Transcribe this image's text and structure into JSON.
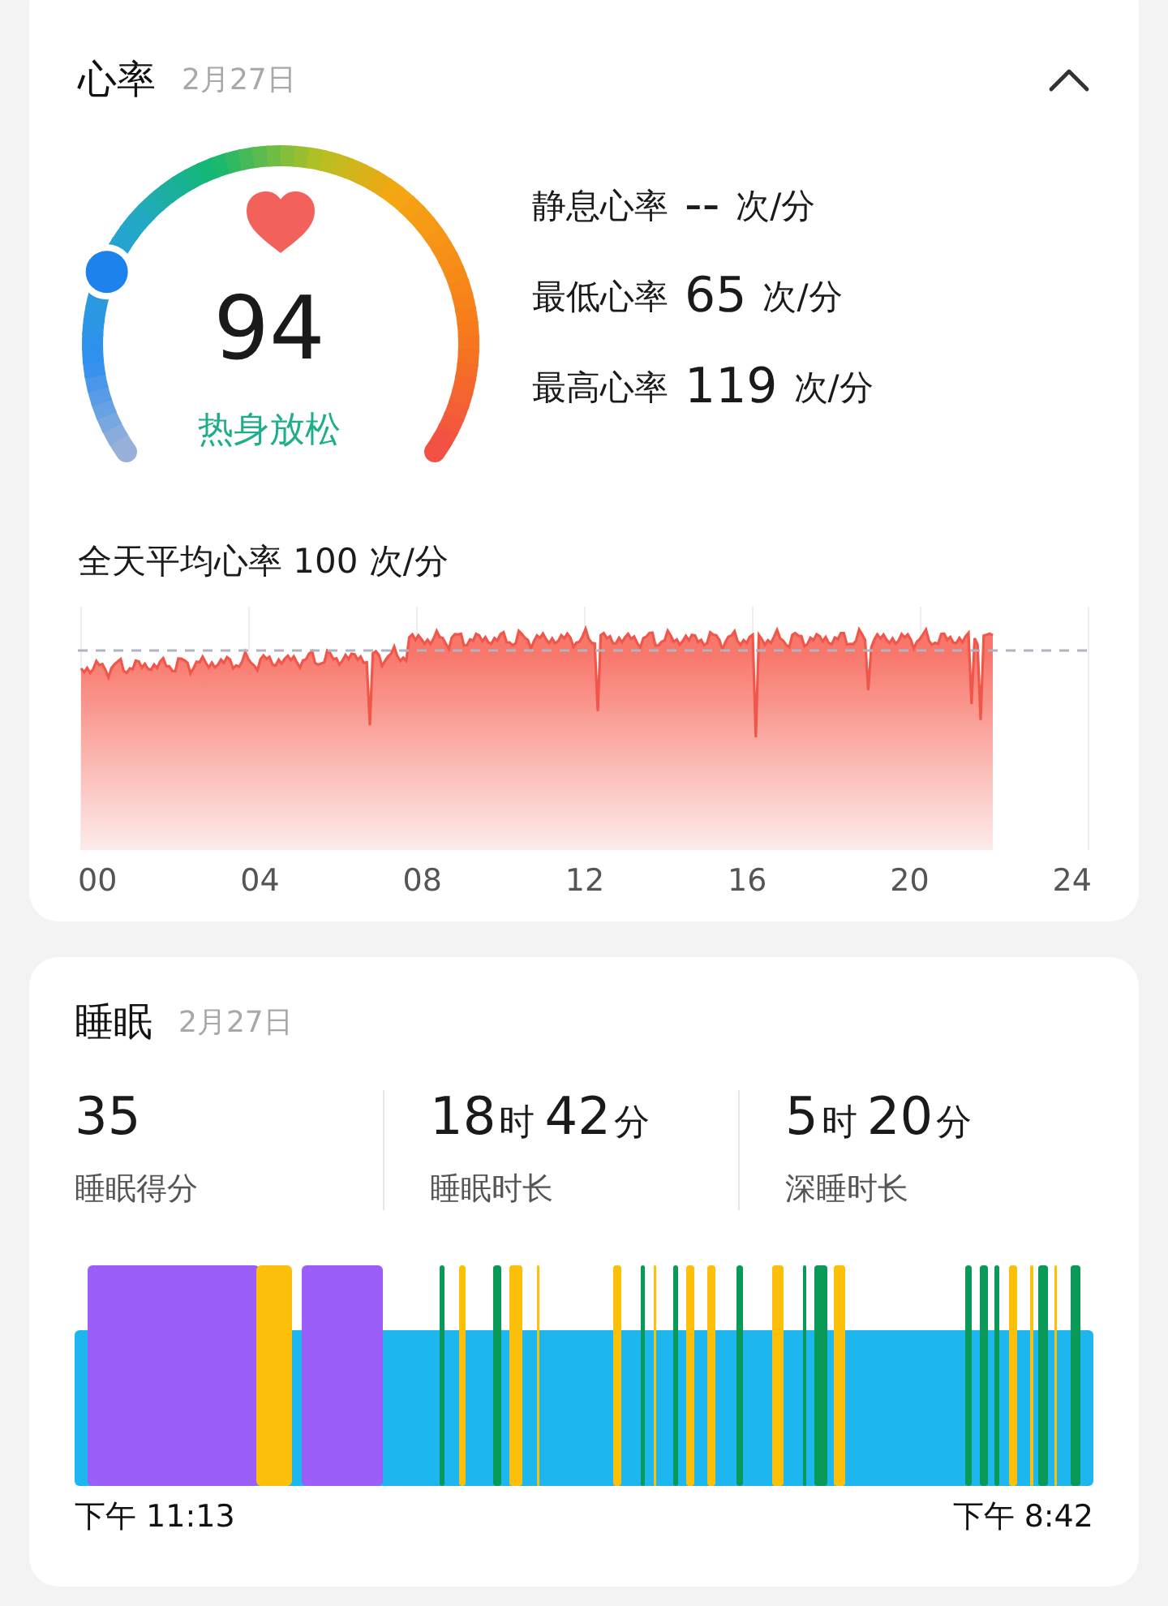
{
  "heart_rate": {
    "title": "心率",
    "date": "2月27日",
    "expanded": true,
    "gauge": {
      "value": "94",
      "zone": "热身放松"
    },
    "stats": [
      {
        "label": "静息心率",
        "value": "--",
        "unit": "次/分"
      },
      {
        "label": "最低心率",
        "value": "65",
        "unit": "次/分"
      },
      {
        "label": "最高心率",
        "value": "119",
        "unit": "次/分"
      }
    ],
    "daily_average": "全天平均心率 100 次/分",
    "x_labels": [
      "00",
      "04",
      "08",
      "12",
      "16",
      "20",
      "24"
    ]
  },
  "sleep": {
    "title": "睡眠",
    "date": "2月27日",
    "stats": [
      {
        "label": "睡眠得分",
        "value": [
          {
            "number": "35"
          }
        ]
      },
      {
        "label": "睡眠时长",
        "value": [
          {
            "number": "18",
            "unit": "时"
          },
          {
            "number": "42",
            "unit": "分"
          }
        ]
      },
      {
        "label": "深睡时长",
        "value": [
          {
            "number": "5",
            "unit": "时"
          },
          {
            "number": "20",
            "unit": "分"
          }
        ]
      }
    ],
    "start_time": "下午 11:13",
    "end_time": "下午 8:42"
  }
}
